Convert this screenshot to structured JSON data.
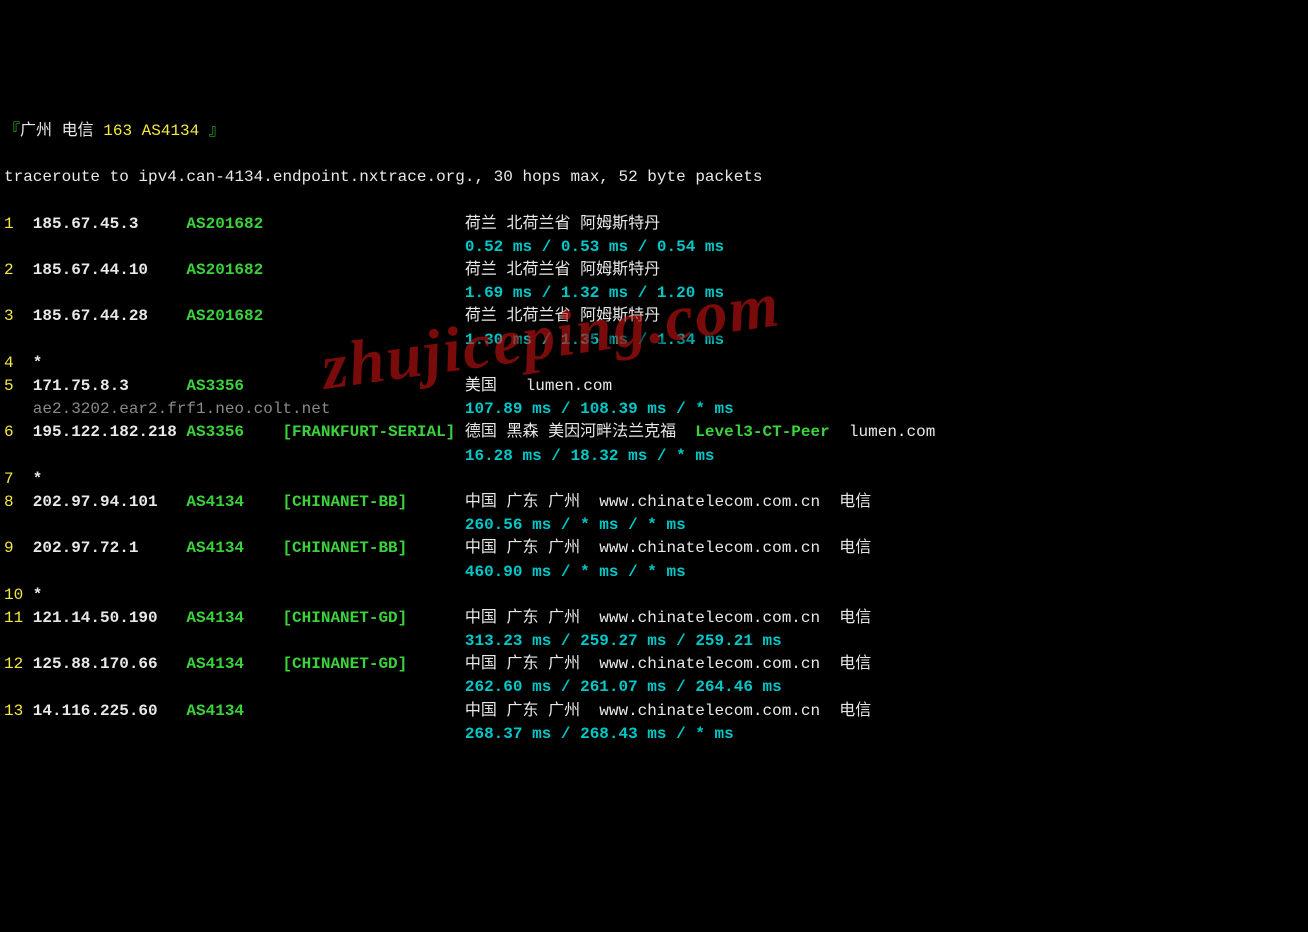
{
  "header": {
    "bracket_open": "『",
    "city": "广州 电信",
    "route": "163 AS4134",
    "bracket_close": " 』"
  },
  "cmd": "traceroute to ipv4.can-4134.endpoint.nxtrace.org., 30 hops max, 52 byte packets",
  "hops": [
    {
      "n": "1",
      "ip": "185.67.45.3",
      "as": "AS201682",
      "tag": "",
      "loc": "荷兰 北荷兰省 阿姆斯特丹",
      "extra": "",
      "t": "0.52 ms / 0.53 ms / 0.54 ms"
    },
    {
      "n": "2",
      "ip": "185.67.44.10",
      "as": "AS201682",
      "tag": "",
      "loc": "荷兰 北荷兰省 阿姆斯特丹",
      "extra": "",
      "t": "1.69 ms / 1.32 ms / 1.20 ms"
    },
    {
      "n": "3",
      "ip": "185.67.44.28",
      "as": "AS201682",
      "tag": "",
      "loc": "荷兰 北荷兰省 阿姆斯特丹",
      "extra": "",
      "t": "1.30 ms / 1.35 ms / 1.34 ms"
    },
    {
      "n": "4",
      "star": "*"
    },
    {
      "n": "5",
      "ip": "171.75.8.3",
      "as": "AS3356",
      "tag": "",
      "loc": "美国   lumen.com",
      "extra": "",
      "sub": "ae2.3202.ear2.frf1.neo.colt.net",
      "t": "107.89 ms / 108.39 ms / * ms"
    },
    {
      "n": "6",
      "ip": "195.122.182.218",
      "as": "AS3356",
      "tag": "[FRANKFURT-SERIAL]",
      "loc": "德国 黑森 美因河畔法兰克福  ",
      "extra": "Level3-CT-Peer  lumen.com",
      "t": "16.28 ms / 18.32 ms / * ms"
    },
    {
      "n": "7",
      "star": "*"
    },
    {
      "n": "8",
      "ip": "202.97.94.101",
      "as": "AS4134",
      "tag": "[CHINANET-BB]",
      "loc": "中国 广东 广州  www.chinatelecom.com.cn  电信",
      "extra": "",
      "t": "260.56 ms / * ms / * ms"
    },
    {
      "n": "9",
      "ip": "202.97.72.1",
      "as": "AS4134",
      "tag": "[CHINANET-BB]",
      "loc": "中国 广东 广州  www.chinatelecom.com.cn  电信",
      "extra": "",
      "t": "460.90 ms / * ms / * ms"
    },
    {
      "n": "10",
      "star": "*"
    },
    {
      "n": "11",
      "ip": "121.14.50.190",
      "as": "AS4134",
      "tag": "[CHINANET-GD]",
      "loc": "中国 广东 广州  www.chinatelecom.com.cn  电信",
      "extra": "",
      "t": "313.23 ms / 259.27 ms / 259.21 ms"
    },
    {
      "n": "12",
      "ip": "125.88.170.66",
      "as": "AS4134",
      "tag": "[CHINANET-GD]",
      "loc": "中国 广东 广州  www.chinatelecom.com.cn  电信",
      "extra": "",
      "t": "262.60 ms / 261.07 ms / 264.46 ms"
    },
    {
      "n": "13",
      "ip": "14.116.225.60",
      "as": "AS4134",
      "tag": "",
      "loc": "中国 广东 广州  www.chinatelecom.com.cn  电信",
      "extra": "",
      "t": "268.37 ms / 268.43 ms / * ms"
    }
  ],
  "watermark": "zhujiceping.com"
}
